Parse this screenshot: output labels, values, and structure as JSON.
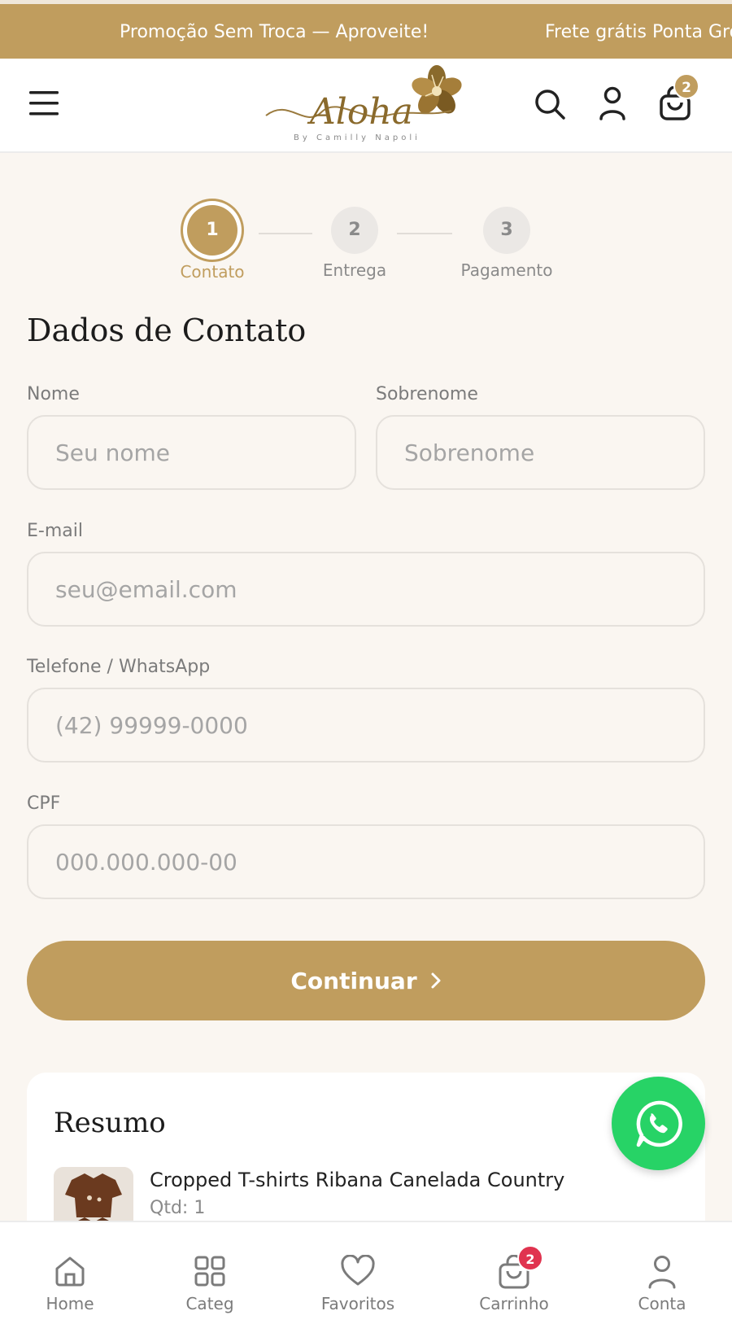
{
  "announcement": {
    "messages": [
      "Promoção Sem Troca — Aproveite!",
      "Frete grátis Ponta Gro"
    ]
  },
  "header": {
    "logo_text": "Aloha",
    "logo_subtext": "By Camilly Napoli",
    "cart_count": "2"
  },
  "stepper": {
    "steps": [
      {
        "number": "1",
        "label": "Contato",
        "active": true
      },
      {
        "number": "2",
        "label": "Entrega",
        "active": false
      },
      {
        "number": "3",
        "label": "Pagamento",
        "active": false
      }
    ]
  },
  "form": {
    "title": "Dados de Contato",
    "nome": {
      "label": "Nome",
      "placeholder": "Seu nome",
      "value": ""
    },
    "sobrenome": {
      "label": "Sobrenome",
      "placeholder": "Sobrenome",
      "value": ""
    },
    "email": {
      "label": "E-mail",
      "placeholder": "seu@email.com",
      "value": ""
    },
    "telefone": {
      "label": "Telefone / WhatsApp",
      "placeholder": "(42) 99999-0000",
      "value": ""
    },
    "cpf": {
      "label": "CPF",
      "placeholder": "000.000.000-00",
      "value": ""
    },
    "continue_label": "Continuar"
  },
  "summary": {
    "title": "Resumo",
    "items": [
      {
        "name": "Cropped T-shirts Ribana Canelada Country",
        "qty": "Qtd: 1"
      }
    ]
  },
  "bottom_nav": {
    "items": [
      {
        "label": "Home",
        "icon": "home-icon"
      },
      {
        "label": "Categ",
        "icon": "grid-icon"
      },
      {
        "label": "Favoritos",
        "icon": "heart-icon"
      },
      {
        "label": "Carrinho",
        "icon": "bag-icon",
        "badge": "2"
      },
      {
        "label": "Conta",
        "icon": "user-icon"
      }
    ]
  },
  "colors": {
    "accent": "#c09d5e",
    "background": "#faf6f1",
    "whatsapp": "#27d366",
    "badge_red": "#e0334f"
  }
}
